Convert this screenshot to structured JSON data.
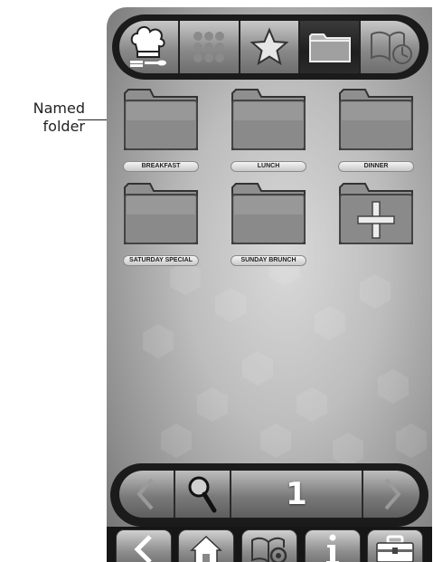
{
  "annotation": {
    "text_line1": "Named",
    "text_line2": "folder"
  },
  "top_tabs": [
    {
      "icon": "chef-hat-icon"
    },
    {
      "icon": "grid-icon"
    },
    {
      "icon": "star-icon"
    },
    {
      "icon": "folder-icon",
      "active": true
    },
    {
      "icon": "recipe-book-icon"
    }
  ],
  "folders": [
    {
      "label": "BREAKFAST"
    },
    {
      "label": "LUNCH"
    },
    {
      "label": "DINNER"
    },
    {
      "label": "SATURDAY SPECIAL"
    },
    {
      "label": "SUNDAY BRUNCH"
    }
  ],
  "add_folder_icon": "plus-icon",
  "pager": {
    "page": "1"
  },
  "bottom_nav": [
    {
      "icon": "back-arrow-icon"
    },
    {
      "icon": "home-icon"
    },
    {
      "icon": "settings-book-icon"
    },
    {
      "icon": "info-icon"
    },
    {
      "icon": "toolbox-icon"
    }
  ],
  "colors": {
    "accent_dark": "#1b1b1b",
    "button_light": "#c8c8c8",
    "text_white": "#ffffff"
  }
}
